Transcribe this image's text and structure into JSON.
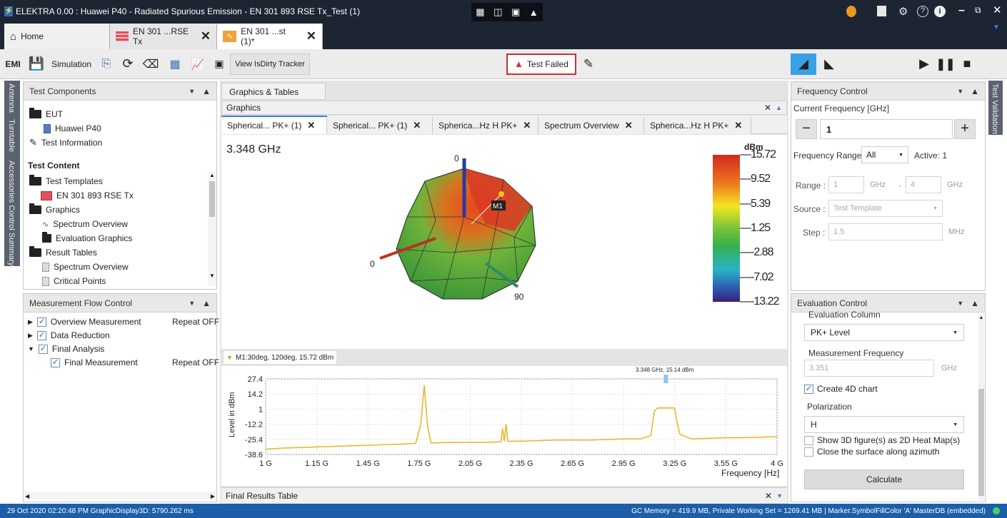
{
  "window": {
    "title": "ELEKTRA 0.00 : Huawei P40 - Radiated Spurious Emission - EN 301 893 RSE Tx_Test (1)"
  },
  "doc_tabs": [
    {
      "label": "Home"
    },
    {
      "label": "EN 301 ...RSE Tx"
    },
    {
      "label": "EN 301 ...st (1)*"
    }
  ],
  "toolbar": {
    "emi_label": "EMI",
    "simulation_label": "Simulation",
    "view_dirty_label": "View IsDirty Tracker",
    "test_status": "Test Failed"
  },
  "left_side_tabs": [
    "Antenna",
    "Turntable",
    "Accessories Control Summary"
  ],
  "right_side_tabs": [
    "Test Validation"
  ],
  "test_components": {
    "title": "Test Components",
    "items": [
      {
        "label": "EUT"
      },
      {
        "label": "Huawei P40"
      },
      {
        "label": "Test Information"
      },
      {
        "label": "Test Content"
      },
      {
        "label": "Test Templates"
      },
      {
        "label": "EN 301 893 RSE Tx"
      },
      {
        "label": "Graphics"
      },
      {
        "label": "Spectrum Overview"
      },
      {
        "label": "Evaluation Graphics"
      },
      {
        "label": "Result Tables"
      },
      {
        "label": "Spectrum Overview"
      },
      {
        "label": "Critical Points"
      }
    ]
  },
  "measurement_flow": {
    "title": "Measurement Flow Control",
    "rows": [
      {
        "label": "Overview Measurement",
        "repeat": "Repeat OFF"
      },
      {
        "label": "Data Reduction",
        "repeat": ""
      },
      {
        "label": "Final Analysis",
        "repeat": ""
      },
      {
        "label": "Final Measurement",
        "repeat": "Repeat OFF"
      }
    ]
  },
  "center": {
    "panel_tab": "Graphics & Tables",
    "graphics_label": "Graphics",
    "subtabs": [
      {
        "label": "Spherical... PK+ (1)"
      },
      {
        "label": "Spherical... PK+ (1)"
      },
      {
        "label": "Spherica...Hz H PK+"
      },
      {
        "label": "Spectrum Overview"
      },
      {
        "label": "Spherica...Hz H PK+"
      }
    ],
    "frequency_readout": "3.348 GHz",
    "marker_label": "M1",
    "axis_labels": {
      "z": "0",
      "x": "0",
      "y": "90"
    },
    "colorbar_unit": "dBm",
    "colorbar_ticks": [
      "15.72",
      "9.52",
      "5.39",
      "1.25",
      "-2.88",
      "-7.02",
      "-13.22"
    ],
    "marker_info": "M1:30deg, 120deg, 15.72 dBm",
    "final_results_label": "Final Results Table"
  },
  "chart_data": {
    "type": "line",
    "title": "",
    "xlabel": "Frequency [Hz]",
    "ylabel": "Level in dBm",
    "x_ticks": [
      "1 G",
      "1.15 G",
      "1.45 G",
      "1.75 G",
      "2.05 G",
      "2.35 G",
      "2.65 G",
      "2.95 G",
      "3.25 G",
      "3.55 G",
      "4 G"
    ],
    "y_ticks": [
      "27.4",
      "14.2",
      "1",
      "-12.2",
      "-25.4",
      "-38.6"
    ],
    "xlim": [
      1.0,
      4.0
    ],
    "ylim": [
      -38.6,
      27.4
    ],
    "peak_annotation": "3.348 GHz, 15.14 dBm",
    "color": "#e8b423",
    "series": [
      {
        "x": [
          1.0,
          1.1,
          1.2,
          1.3,
          1.4,
          1.5,
          1.6,
          1.7,
          1.8,
          1.88,
          1.91,
          1.93,
          1.95,
          1.97,
          2.0,
          2.1,
          2.2,
          2.3,
          2.38,
          2.39,
          2.4,
          2.41,
          2.42,
          2.43,
          2.5,
          2.6,
          2.7,
          2.8,
          2.9,
          3.0,
          3.1,
          3.2,
          3.26,
          3.28,
          3.3,
          3.35,
          3.4,
          3.41,
          3.43,
          3.5,
          3.6,
          3.7,
          3.8,
          3.9,
          4.0
        ],
        "y": [
          -34,
          -33,
          -32.5,
          -32,
          -31.5,
          -31,
          -30.5,
          -30,
          -29.5,
          -29,
          -12,
          22,
          -14,
          -28.5,
          -28.5,
          -28,
          -28,
          -28,
          -27.5,
          -16,
          -27,
          -12,
          -27,
          -27,
          -27,
          -26.5,
          -26,
          -26,
          -26,
          -25.5,
          -25,
          -25,
          -22,
          -1,
          2,
          2,
          2,
          -8,
          -21,
          -25,
          -24.5,
          -24,
          -24,
          -23.5,
          -23
        ]
      }
    ]
  },
  "frequency_control": {
    "title": "Frequency Control",
    "current_label": "Current Frequency [GHz]",
    "current_value": "1",
    "range_label": "Frequency Range",
    "range_value": "All",
    "active_label": "Active: 1",
    "range_from_label": "Range :",
    "range_from": "1",
    "range_unit1": "GHz",
    "range_dash": "-",
    "range_to": "4",
    "range_unit2": "GHz",
    "source_label": "Source :",
    "source_value": "Test Template",
    "step_label": "Step :",
    "step_value": "1.5",
    "step_unit": "MHz"
  },
  "evaluation_control": {
    "title": "Evaluation Control",
    "column_label": "Evaluation Column",
    "column_value": "PK+ Level",
    "freq_label": "Measurement Frequency",
    "freq_value": "3.351",
    "freq_unit": "GHz",
    "create4d_label": "Create 4D chart",
    "polarization_label": "Polarization",
    "polarization_value": "H",
    "show3d_label": "Show 3D figure(s) as 2D Heat Map(s)",
    "close_surface_label": "Close the surface along azimuth",
    "calculate_label": "Calculate"
  },
  "status": {
    "left": "29 Oct 2020 02:20:48 PM  GraphicDisplay3D: 5790.262 ms",
    "right": "GC Memory = 419.9 MB,  Private Working Set = 1269.41 MB |  Marker.SymbolFillColor  'A'  MasterDB (embedded)"
  }
}
